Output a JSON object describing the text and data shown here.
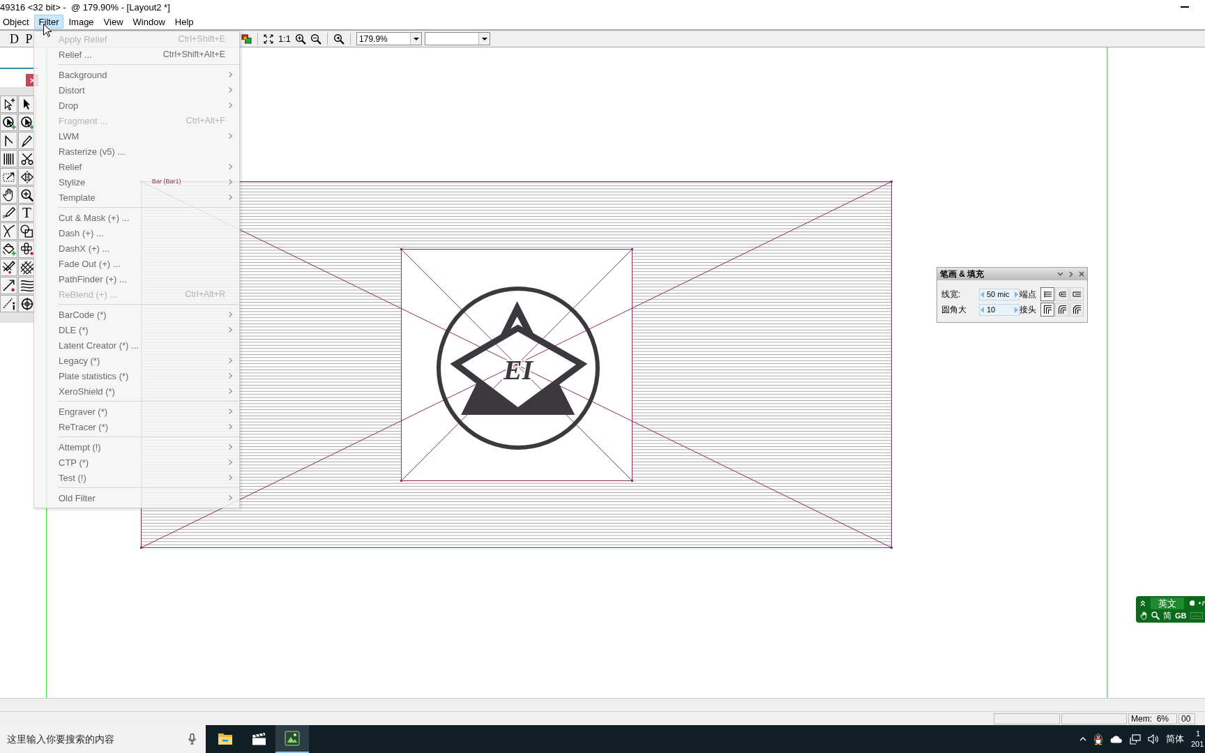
{
  "title_bar": {
    "title": "49316 <32 bit> -  @ 179.90% - [Layout2 *]"
  },
  "menu_bar": [
    {
      "label": "Object",
      "selected": false
    },
    {
      "label": "Filter",
      "selected": true
    },
    {
      "label": "Image",
      "selected": false
    },
    {
      "label": "View",
      "selected": false
    },
    {
      "label": "Window",
      "selected": false
    },
    {
      "label": "Help",
      "selected": false
    }
  ],
  "toolbar": {
    "letter_buttons": [
      "D",
      "P"
    ],
    "actual_size_button": "1:1",
    "zoom_combo": {
      "value": "179.9%"
    }
  },
  "filter_menu": {
    "groups": [
      [
        {
          "label": "Apply Relief",
          "shortcut": "Ctrl+Shift+E",
          "submenu": false,
          "disabled": true
        },
        {
          "label": "Relief ...",
          "shortcut": "Ctrl+Shift+Alt+E",
          "submenu": false,
          "disabled": false
        }
      ],
      [
        {
          "label": "Background",
          "submenu": true,
          "disabled": false
        },
        {
          "label": "Distort",
          "submenu": true,
          "disabled": false
        },
        {
          "label": "Drop",
          "submenu": true,
          "disabled": false
        },
        {
          "label": "Fragment ...",
          "shortcut": "Ctrl+Alt+F",
          "submenu": false,
          "disabled": true
        },
        {
          "label": "LWM",
          "submenu": true,
          "disabled": false
        },
        {
          "label": "Rasterize (v5) ...",
          "submenu": false,
          "disabled": false
        },
        {
          "label": "Relief",
          "submenu": true,
          "disabled": false
        },
        {
          "label": "Stylize",
          "submenu": true,
          "disabled": false
        },
        {
          "label": "Template",
          "submenu": true,
          "disabled": false
        }
      ],
      [
        {
          "label": "Cut & Mask (+) ...",
          "submenu": false,
          "disabled": false
        },
        {
          "label": "Dash (+) ...",
          "submenu": false,
          "disabled": false
        },
        {
          "label": "DashX (+) ...",
          "submenu": false,
          "disabled": false
        },
        {
          "label": "Fade Out (+) ...",
          "submenu": false,
          "disabled": false
        },
        {
          "label": "PathFinder (+) ...",
          "submenu": false,
          "disabled": false
        },
        {
          "label": "ReBlend (+) ...",
          "shortcut": "Ctrl+Alt+R",
          "submenu": false,
          "disabled": true
        }
      ],
      [
        {
          "label": "BarCode (*)",
          "submenu": true,
          "disabled": false
        },
        {
          "label": "DLE (*)",
          "submenu": true,
          "disabled": false
        },
        {
          "label": "Latent Creator (*) ...",
          "submenu": false,
          "disabled": false
        },
        {
          "label": "Legacy (*)",
          "submenu": true,
          "disabled": false
        },
        {
          "label": "Plate statistics (*)",
          "submenu": true,
          "disabled": false
        },
        {
          "label": "XeroShield (*)",
          "submenu": true,
          "disabled": false
        }
      ],
      [
        {
          "label": "Engraver (*)",
          "submenu": true,
          "disabled": false
        },
        {
          "label": "ReTracer (*)",
          "submenu": true,
          "disabled": false
        }
      ],
      [
        {
          "label": "Attempt (!)",
          "submenu": true,
          "disabled": false
        },
        {
          "label": "CTP (*)",
          "submenu": true,
          "disabled": false
        },
        {
          "label": "Test (!)",
          "submenu": true,
          "disabled": false
        }
      ],
      [
        {
          "label": "Old Filter",
          "submenu": true,
          "disabled": false
        }
      ]
    ]
  },
  "toolbox": {
    "text_tool": "T"
  },
  "canvas": {
    "object_label": "Bar (Bar1)",
    "logo_monogram": "EI"
  },
  "stroke_fill_panel": {
    "title": "笔画 & 填充",
    "rows": [
      {
        "kind": "cap",
        "label": "线宽:",
        "value": "50 mic",
        "option_label": "端点",
        "options": [
          {
            "selected": true
          },
          {
            "selected": false
          },
          {
            "selected": false
          }
        ]
      },
      {
        "kind": "join",
        "label": "圆角大",
        "value": "10",
        "option_label": "接头",
        "options": [
          {
            "selected": true
          },
          {
            "selected": false
          },
          {
            "selected": false
          }
        ]
      }
    ]
  },
  "ime_widget": {
    "mode": "英文",
    "script": "简",
    "charset": "GB"
  },
  "status_bar": {
    "memory": "Mem:  6%",
    "field_4": "00"
  },
  "taskbar": {
    "search": {
      "placeholder": "这里输入你要搜索的内容"
    },
    "apps": [
      {
        "kind": "folder",
        "selected": false
      },
      {
        "kind": "clapper",
        "selected": false
      },
      {
        "kind": "app",
        "selected": true
      }
    ],
    "input_method": "简体",
    "clock": [
      "1",
      "201"
    ]
  }
}
